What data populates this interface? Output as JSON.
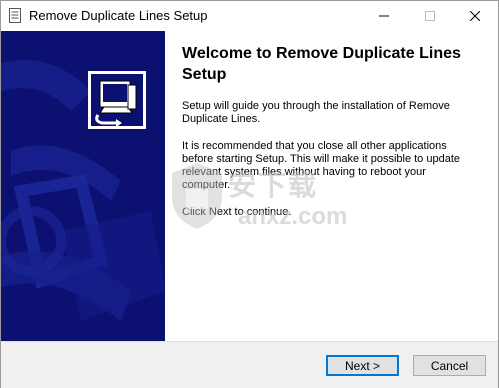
{
  "window": {
    "title": "Remove Duplicate Lines Setup"
  },
  "icons": {
    "app": "installer-document-icon",
    "minimize": "minimize-icon",
    "maximize": "maximize-icon",
    "close": "close-icon",
    "logo": "computer-install-icon"
  },
  "main": {
    "heading": "Welcome to Remove Duplicate Lines Setup",
    "paragraph1": "Setup will guide you through the installation of Remove Duplicate Lines.",
    "paragraph2": "It is recommended that you close all other applications before starting Setup. This will make it possible to update relevant system files without having to reboot your computer.",
    "paragraph3": "Click Next to continue."
  },
  "watermark": {
    "text": "安下载",
    "subtext": "anxz.com"
  },
  "buttons": {
    "next": "Next >",
    "cancel": "Cancel"
  },
  "colors": {
    "side_panel": "#0c1070",
    "accent": "#0078d7"
  }
}
